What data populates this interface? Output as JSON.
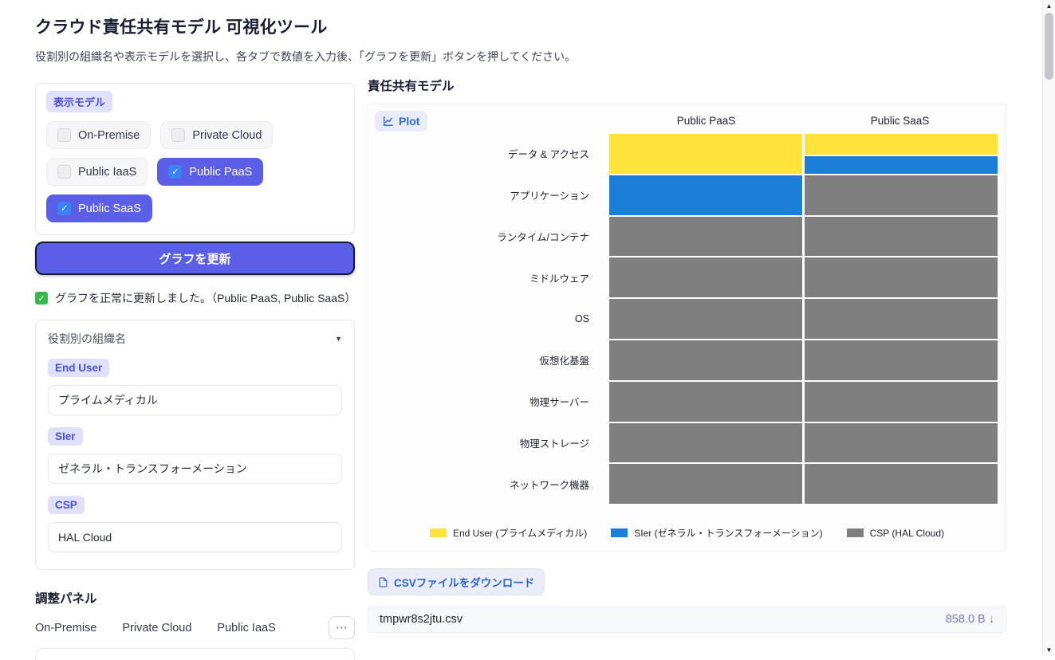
{
  "colors": {
    "accent": "#5b5fe8",
    "badge_bg": "#dfe1fb",
    "badge_text": "#4b4fd0",
    "checkbox_blue": "#3b82f6",
    "success_green": "#3cb54a",
    "plot_blue": "#2f6bdf",
    "csv_blue": "#2a63d4",
    "file_purple": "#7477cd"
  },
  "icons": {
    "check": "✓",
    "chevron_down": "▼",
    "ellipsis": "⋯",
    "download_arrow": "↓",
    "scroll_up": "▲",
    "scroll_down": "▼"
  },
  "page": {
    "title": "クラウド責任共有モデル 可視化ツール",
    "subtitle": "役割別の組織名や表示モデルを選択し、各タブで数値を入力後、「グラフを更新」ボタンを押してください。"
  },
  "model_selector": {
    "label": "表示モデル",
    "options": [
      {
        "label": "On-Premise",
        "checked": false
      },
      {
        "label": "Private Cloud",
        "checked": false
      },
      {
        "label": "Public IaaS",
        "checked": false
      },
      {
        "label": "Public PaaS",
        "checked": true
      },
      {
        "label": "Public SaaS",
        "checked": true
      }
    ]
  },
  "update_button": {
    "label": "グラフを更新"
  },
  "status": {
    "text": "グラフを正常に更新しました。（Public PaaS, Public SaaS）"
  },
  "org_accordion": {
    "title": "役割別の組織名",
    "fields": [
      {
        "badge": "End User",
        "value": "プライムメディカル"
      },
      {
        "badge": "SIer",
        "value": "ゼネラル・トランスフォーメーション"
      },
      {
        "badge": "CSP",
        "value": "HAL Cloud"
      }
    ]
  },
  "adjust_panel": {
    "title": "調整パネル",
    "tabs": [
      "On-Premise",
      "Private Cloud",
      "Public IaaS"
    ],
    "overflow_label": "⋯"
  },
  "plot_section": {
    "title": "責任共有モデル",
    "plot_label": "Plot"
  },
  "chart_data": {
    "type": "heatmap",
    "title": "責任共有モデル",
    "columns": [
      "Public PaaS",
      "Public SaaS"
    ],
    "rows": [
      "データ & アクセス",
      "アプリケーション",
      "ランタイム/コンテナ",
      "ミドルウェア",
      "OS",
      "仮想化基盤",
      "物理サーバー",
      "物理ストレージ",
      "ネットワーク機器"
    ],
    "legend": [
      {
        "key": "end_user",
        "name": "End User (プライムメディカル)",
        "color": "#ffe23c"
      },
      {
        "key": "sier",
        "name": "SIer (ゼネラル・トランスフォーメーション)",
        "color": "#1d7ed8"
      },
      {
        "key": "csp",
        "name": "CSP (HAL Cloud)",
        "color": "#7f7f7f"
      }
    ],
    "legend_position": "bottom-center",
    "cells": {
      "Public PaaS": [
        [
          {
            "owner": "end_user",
            "fraction": 1.0
          }
        ],
        [
          {
            "owner": "sier",
            "fraction": 1.0
          }
        ],
        [
          {
            "owner": "csp",
            "fraction": 1.0
          }
        ],
        [
          {
            "owner": "csp",
            "fraction": 1.0
          }
        ],
        [
          {
            "owner": "csp",
            "fraction": 1.0
          }
        ],
        [
          {
            "owner": "csp",
            "fraction": 1.0
          }
        ],
        [
          {
            "owner": "csp",
            "fraction": 1.0
          }
        ],
        [
          {
            "owner": "csp",
            "fraction": 1.0
          }
        ],
        [
          {
            "owner": "csp",
            "fraction": 1.0
          }
        ]
      ],
      "Public SaaS": [
        [
          {
            "owner": "end_user",
            "fraction": 0.55
          },
          {
            "owner": "sier",
            "fraction": 0.45
          }
        ],
        [
          {
            "owner": "csp",
            "fraction": 1.0
          }
        ],
        [
          {
            "owner": "csp",
            "fraction": 1.0
          }
        ],
        [
          {
            "owner": "csp",
            "fraction": 1.0
          }
        ],
        [
          {
            "owner": "csp",
            "fraction": 1.0
          }
        ],
        [
          {
            "owner": "csp",
            "fraction": 1.0
          }
        ],
        [
          {
            "owner": "csp",
            "fraction": 1.0
          }
        ],
        [
          {
            "owner": "csp",
            "fraction": 1.0
          }
        ],
        [
          {
            "owner": "csp",
            "fraction": 1.0
          }
        ]
      ]
    }
  },
  "download": {
    "button_label": "CSVファイルをダウンロード",
    "file_name": "tmpwr8s2jtu.csv",
    "file_size": "858.0 B"
  }
}
